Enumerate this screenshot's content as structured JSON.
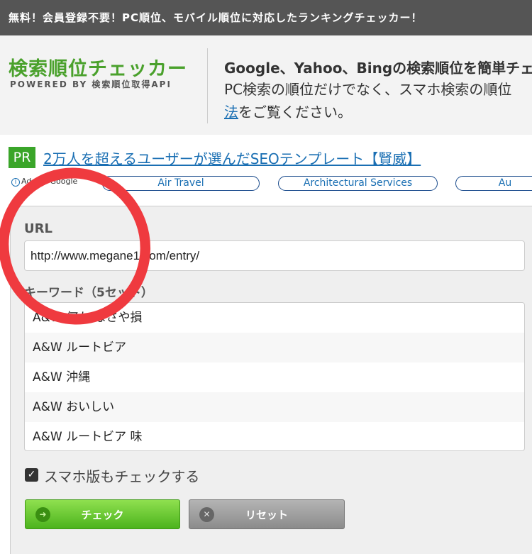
{
  "top_bar": {
    "text": "無料！会員登録不要！PC順位、モバイル順位に対応したランキングチェッカー！"
  },
  "header": {
    "logo": "検索順位チェッカー",
    "logo_sub": "POWERED BY 検索順位取得API",
    "desc_line1": "Google、Yahoo、Bingの検索順位を簡単チェ",
    "desc_line2": "PC検索の順位だけでなく、スマホ検索の順位",
    "desc_link": "法",
    "desc_line3_rest": "をご覧ください。"
  },
  "promo": {
    "badge": "PR",
    "link": "2万人を超えるユーザーが選んだSEOテンプレート【賢威】"
  },
  "ads": {
    "ad_choice": "Ads by Google",
    "pills": [
      "Air Travel",
      "Architectural Services",
      "Au"
    ]
  },
  "form": {
    "url_label": "URL",
    "url_value": "http://www.megane1.com/entry/",
    "keyword_label": "キーワード（5セット）",
    "keywords": [
      "A&W 何か なさや損",
      "A&W ルートビア",
      "A&W 沖縄",
      "A&W おいしい",
      "A&W ルートビア 味"
    ],
    "smartphone_check_label": "スマホ版もチェックする",
    "smartphone_checked": true,
    "check_button": "チェック",
    "reset_button": "リセット"
  },
  "colors": {
    "accent_green": "#4aa12c",
    "link_blue": "#1a6fb3",
    "annotation_red": "#ef3a3f"
  }
}
